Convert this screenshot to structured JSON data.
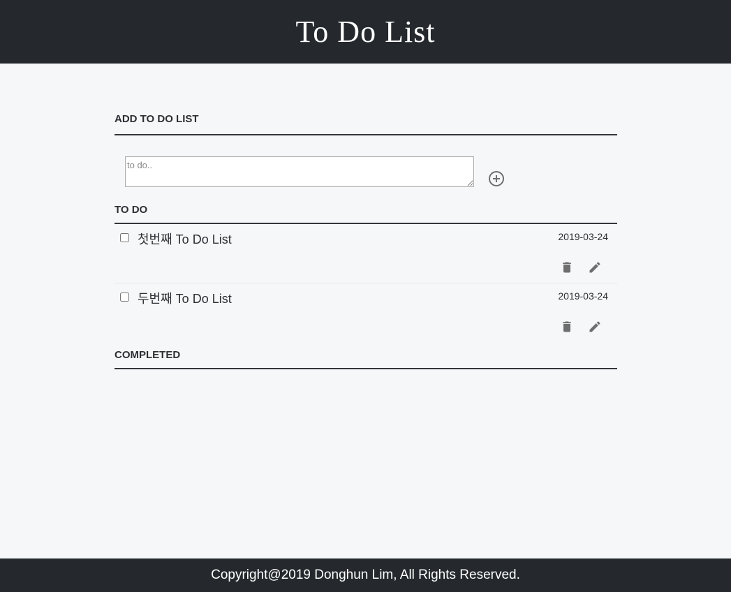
{
  "header": {
    "title": "To Do List"
  },
  "add_section": {
    "title": "ADD TO DO LIST",
    "input_placeholder": "to do..",
    "input_value": ""
  },
  "todo_section": {
    "title": "TO DO",
    "items": [
      {
        "text": "첫번째 To Do List",
        "date": "2019-03-24",
        "checked": false
      },
      {
        "text": "두번째 To Do List",
        "date": "2019-03-24",
        "checked": false
      }
    ]
  },
  "completed_section": {
    "title": "COMPLETED",
    "items": []
  },
  "footer": {
    "copyright": "Copyright@2019 Donghun Lim, All Rights Reserved."
  },
  "icons": {
    "add": "plus-circle-icon",
    "delete": "trash-icon",
    "edit": "pencil-icon"
  },
  "colors": {
    "header_bg": "#25292d",
    "page_bg": "#f6f7f9",
    "icon": "#6e6e6e"
  }
}
